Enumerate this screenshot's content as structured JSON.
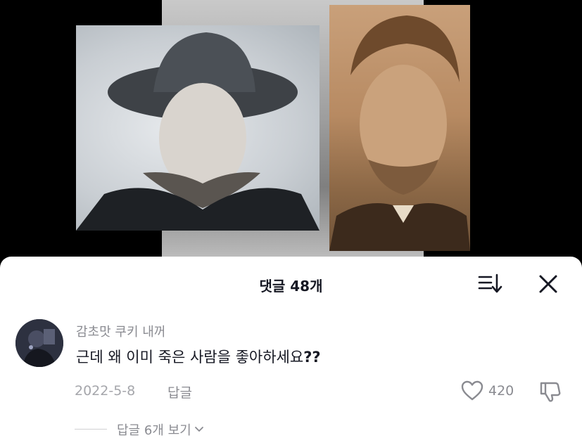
{
  "sheet": {
    "title": "댓글 48개",
    "sort_icon": "sort-icon",
    "close_icon": "close-icon"
  },
  "comment": {
    "username": "감초맛 쿠키 내꺼",
    "text_main": "근데 왜 이미 죽은 사람을 좋아하세요",
    "text_punct": "??",
    "date": "2022-5-8",
    "reply_label": "답글",
    "like_count": "420",
    "like_icon": "heart-icon",
    "dislike_icon": "thumbs-down-icon"
  },
  "replies": {
    "label": "답글 6개 보기"
  },
  "colors": {
    "sheet_bg": "#ffffff",
    "primary_text": "#161823",
    "secondary_text": "#8a8b91"
  }
}
